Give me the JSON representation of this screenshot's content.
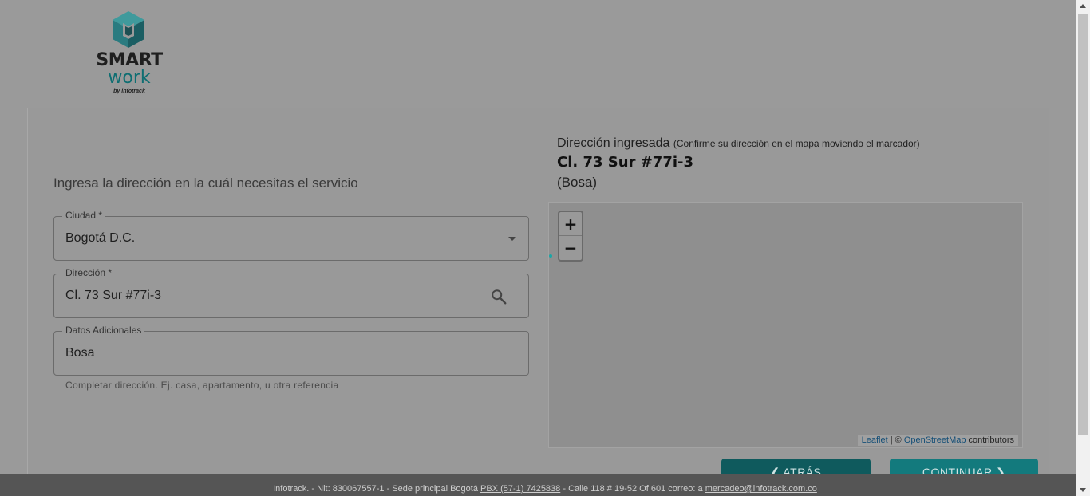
{
  "logo": {
    "brand_line1": "SMART",
    "brand_line2": "work",
    "byline": "by infotrack"
  },
  "form": {
    "title": "Ingresa la dirección en la cuál necesitas el servicio",
    "ciudad": {
      "label": "Ciudad *",
      "value": "Bogotá D.C."
    },
    "direccion": {
      "label": "Dirección *",
      "value": "Cl. 73 Sur #77i-3"
    },
    "datos": {
      "label": "Datos Adicionales",
      "value": "Bosa",
      "helper": "Completar dirección. Ej. casa, apartamento, u otra referencia"
    }
  },
  "address": {
    "heading": "Dirección ingresada",
    "hint": "(Confirme su dirección en el mapa moviendo el marcador)",
    "main": "Cl. 73 Sur #77i-3",
    "sub": "(Bosa)"
  },
  "map": {
    "zoom_in": "+",
    "zoom_out": "−",
    "attribution_leaflet": "Leaflet",
    "attribution_sep": " | © ",
    "attribution_osm": "OpenStreetMap",
    "attribution_suffix": " contributors"
  },
  "buttons": {
    "back": "❮ ATRÁS",
    "next": "CONTINUAR ❯"
  },
  "footer": {
    "text1": "Infotrack. - Nit: 830067557-1 - Sede principal Bogotá  ",
    "phone": "PBX (57-1) 7425838",
    "text2": "  - Calle 118 # 19-52 Of 601   correo: a ",
    "email": "mercadeo@infotrack.com.co"
  },
  "colors": {
    "brand_teal": "#0e6e72",
    "button_back": "#0f5a5d",
    "button_next": "#137a7d"
  }
}
